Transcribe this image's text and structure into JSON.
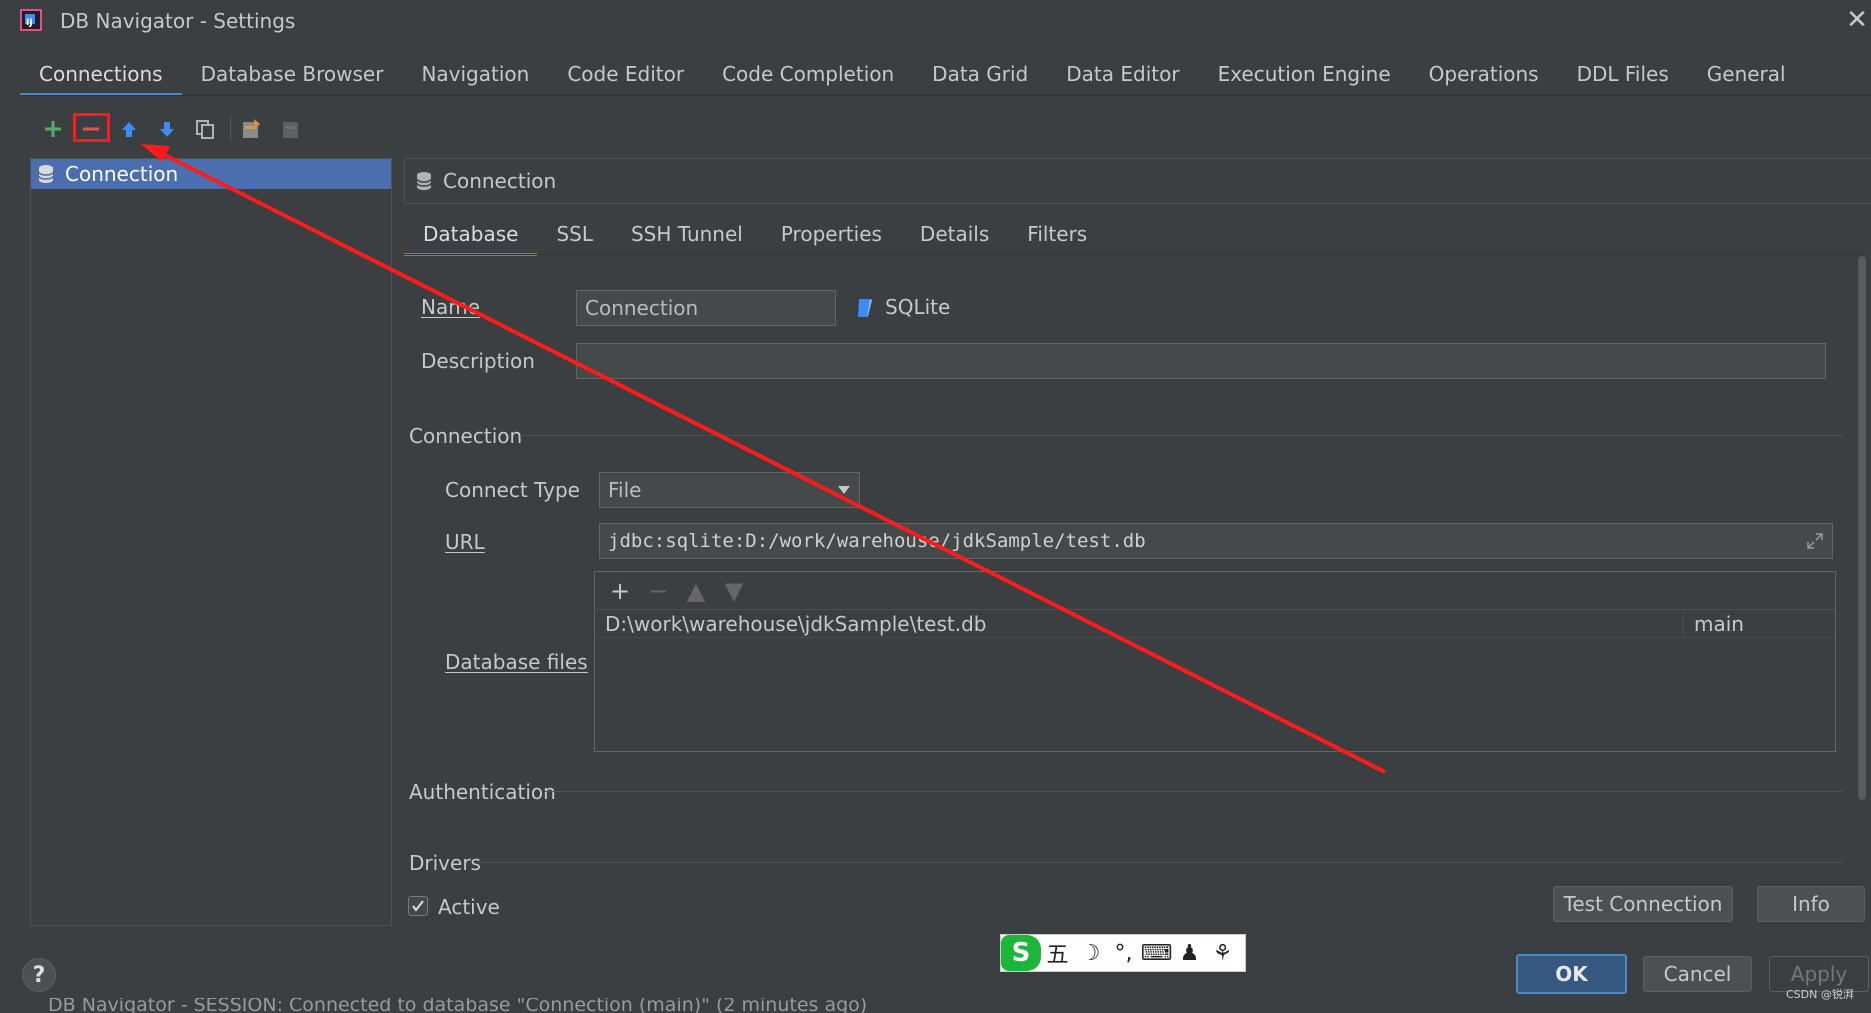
{
  "window": {
    "title": "DB Navigator - Settings",
    "app_icon_text": "IJ"
  },
  "top_tabs": [
    {
      "label": "Connections",
      "active": true
    },
    {
      "label": "Database Browser"
    },
    {
      "label": "Navigation"
    },
    {
      "label": "Code Editor"
    },
    {
      "label": "Code Completion"
    },
    {
      "label": "Data Grid"
    },
    {
      "label": "Data Editor"
    },
    {
      "label": "Execution Engine"
    },
    {
      "label": "Operations"
    },
    {
      "label": "DDL Files"
    },
    {
      "label": "General"
    }
  ],
  "toolbar": {
    "icons": [
      "add-icon",
      "remove-icon",
      "move-up-icon",
      "move-down-icon",
      "copy-icon",
      "export-icon",
      "import-icon"
    ]
  },
  "tree": {
    "items": [
      {
        "label": "Connection",
        "selected": true
      }
    ]
  },
  "panel": {
    "header": "Connection",
    "tabs": [
      {
        "label": "Database",
        "active": true
      },
      {
        "label": "SSL"
      },
      {
        "label": "SSH Tunnel"
      },
      {
        "label": "Properties"
      },
      {
        "label": "Details"
      },
      {
        "label": "Filters"
      }
    ]
  },
  "form": {
    "name_label": "Name",
    "name_value": "Connection",
    "db_type": "SQLite",
    "description_label": "Description",
    "description_value": "",
    "connection_section": "Connection",
    "connect_type_label": "Connect Type",
    "connect_type_value": "File",
    "url_label": "URL",
    "url_value": "jdbc:sqlite:D:/work/warehouse/jdkSample/test.db",
    "database_files_label": "Database files",
    "database_files": [
      {
        "path": "D:\\work\\warehouse\\jdkSample\\test.db",
        "schema": "main"
      }
    ],
    "authentication_section": "Authentication",
    "drivers_section": "Drivers",
    "active_label": "Active",
    "active_checked": true
  },
  "buttons": {
    "test_connection": "Test Connection",
    "info": "Info",
    "ok": "OK",
    "cancel": "Cancel",
    "apply": "Apply",
    "help": "?"
  },
  "ime": {
    "logo": "S",
    "items": [
      "五",
      "☽",
      "°,",
      "⌨",
      "♟",
      "⚘"
    ]
  },
  "status_bar": {
    "text": "DB Navigator - SESSION: Connected to database \"Connection (main)\" (2 minutes ago)"
  },
  "watermark": "CSDN @锐湃",
  "colors": {
    "background": "#3c3f41",
    "selection": "#4b6eaf",
    "accent": "#4a88c7",
    "annotation": "#ff1b1b"
  }
}
